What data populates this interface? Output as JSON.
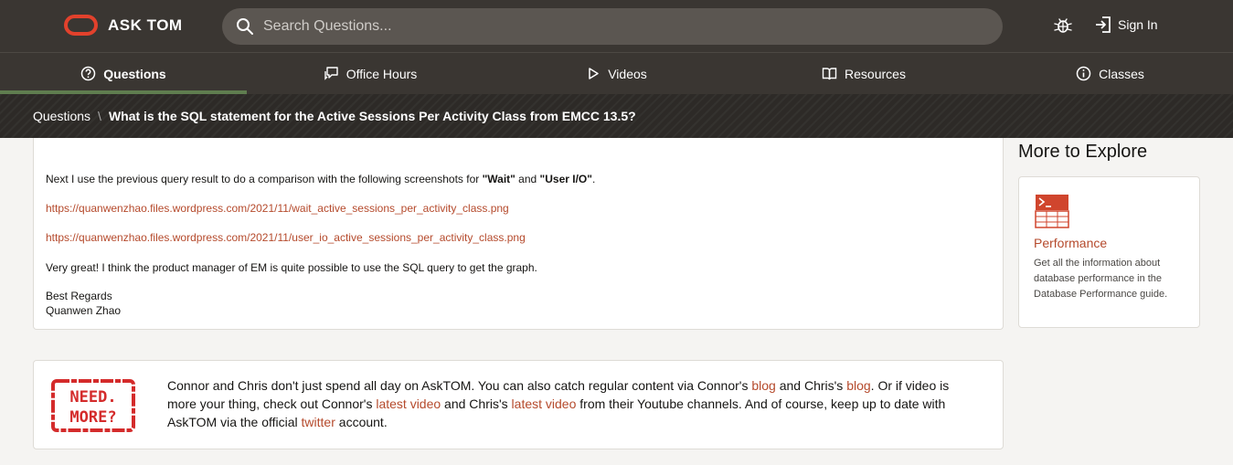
{
  "header": {
    "logo_text": "ASK TOM",
    "search_placeholder": "Search Questions...",
    "signin_label": "Sign In"
  },
  "nav": {
    "items": [
      {
        "label": "Questions",
        "icon": "question-circle-icon",
        "active": true
      },
      {
        "label": "Office Hours",
        "icon": "chat-icon",
        "active": false
      },
      {
        "label": "Videos",
        "icon": "play-icon",
        "active": false
      },
      {
        "label": "Resources",
        "icon": "book-icon",
        "active": false
      },
      {
        "label": "Classes",
        "icon": "info-circle-icon",
        "active": false
      }
    ]
  },
  "breadcrumb": {
    "root": "Questions",
    "separator": "\\",
    "current": "What is the SQL statement for the Active Sessions Per Activity Class from EMCC 13.5?"
  },
  "post": {
    "line1_pre": "Next I use the previous query result to do a comparison with the following screenshots for ",
    "wait": "\"Wait\"",
    "and": " and ",
    "userio": "\"User I/O\"",
    "period": ".",
    "link1": "https://quanwenzhao.files.wordpress.com/2021/11/wait_active_sessions_per_activity_class.png",
    "link2": "https://quanwenzhao.files.wordpress.com/2021/11/user_io_active_sessions_per_activity_class.png",
    "line4": "Very great! I think the product manager of EM is quite possible to use the SQL query to get the graph.",
    "regards": "Best Regards",
    "author": "Quanwen Zhao"
  },
  "explore": {
    "title": "More to Explore",
    "card_title": "Performance",
    "card_desc": "Get all the information about database performance in the Database Performance guide.",
    "icon": "terminal-table-icon"
  },
  "need_more": {
    "stamp_line1": "NEED.",
    "stamp_line2": "MORE?",
    "t1": "Connor and Chris don't just spend all day on AskTOM. You can also catch regular content via Connor's ",
    "blog1": "blog",
    "t2": " and Chris's ",
    "blog2": "blog",
    "t3": ". Or if video is more your thing, check out Connor's ",
    "video1": "latest video",
    "t4": " and Chris's ",
    "video2": "latest video",
    "t5": " from their Youtube channels. And of course, keep up to date with AskTOM via the official ",
    "twitter": "twitter",
    "t6": " account."
  },
  "colors": {
    "accent": "#b54a2c",
    "header_bg": "#3a3632",
    "logo_red": "#e2412c",
    "active_underline": "#5f7d4f",
    "stamp_red": "#d42b2b"
  }
}
